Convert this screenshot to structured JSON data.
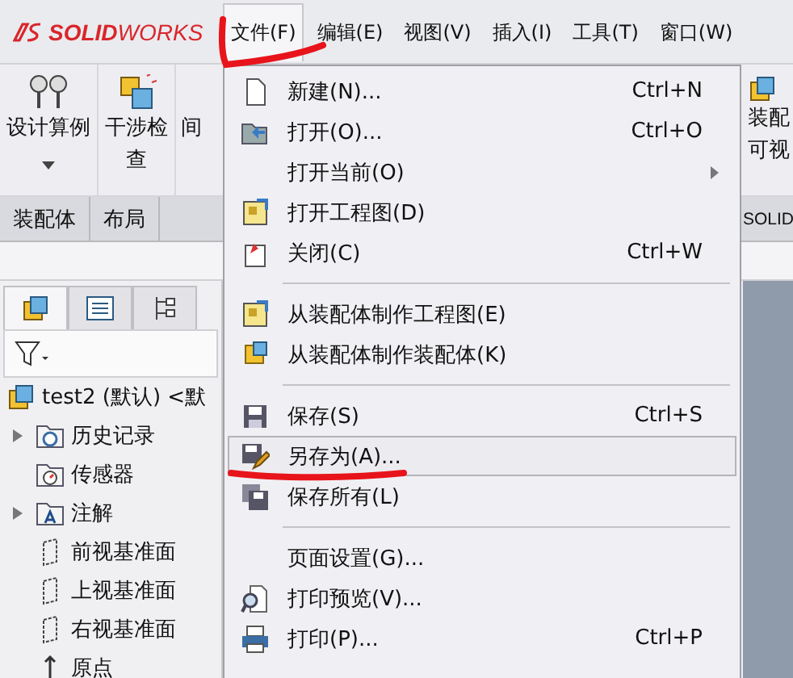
{
  "app_logo": {
    "text": "**SOLID**WORKS"
  },
  "menu_bar": [
    {
      "label": "文件(F)",
      "selected": true
    },
    {
      "label": "编辑(E)",
      "selected": false
    },
    {
      "label": "视图(V)",
      "selected": false
    },
    {
      "label": "插入(I)",
      "selected": false
    },
    {
      "label": "工具(T)",
      "selected": false
    },
    {
      "label": "窗口(W)",
      "selected": false
    }
  ],
  "toolbar": [
    "设计算例",
    "干涉检查",
    "间"
  ],
  "toolbar_right": {
    "label_lines": [
      "装配",
      "可视"
    ]
  },
  "command_tabs": [
    "装配体",
    "布局"
  ],
  "command_tabs_right": "SOLID",
  "panel_tabs": [
    {
      "selected": true
    },
    {
      "selected": false
    },
    {
      "selected": false
    }
  ],
  "tree": {
    "label": "test2 (默认) <默",
    "children": [
      {
        "label": "历史记录",
        "expandable": true
      },
      {
        "label": "传感器",
        "expandable": false
      },
      {
        "label": "注解",
        "expandable": true
      },
      {
        "label": "前视基准面",
        "expandable": false
      },
      {
        "label": "上视基准面",
        "expandable": false
      },
      {
        "label": "右视基准面",
        "expandable": false
      },
      {
        "label": "原点",
        "expandable": false
      }
    ]
  },
  "file_menu": [
    {
      "kind": "item",
      "label": "新建(N)...",
      "shortcut": "Ctrl+N",
      "submenu": false,
      "selected": false
    },
    {
      "kind": "item",
      "label": "打开(O)...",
      "shortcut": "Ctrl+O",
      "submenu": false,
      "selected": false
    },
    {
      "kind": "item",
      "label": "打开当前(O)",
      "submenu": true,
      "selected": false
    },
    {
      "kind": "item",
      "label": "打开工程图(D)",
      "submenu": false,
      "selected": false
    },
    {
      "kind": "item",
      "label": "关闭(C)",
      "shortcut": "Ctrl+W",
      "submenu": false,
      "selected": false
    },
    {
      "kind": "separator"
    },
    {
      "kind": "item",
      "label": "从装配体制作工程图(E)",
      "submenu": false,
      "selected": false
    },
    {
      "kind": "item",
      "label": "从装配体制作装配体(K)",
      "submenu": false,
      "selected": false
    },
    {
      "kind": "separator"
    },
    {
      "kind": "item",
      "label": "保存(S)",
      "shortcut": "Ctrl+S",
      "submenu": false,
      "selected": false
    },
    {
      "kind": "item",
      "label": "另存为(A)...",
      "submenu": false,
      "selected": true
    },
    {
      "kind": "item",
      "label": "保存所有(L)",
      "submenu": false,
      "selected": false
    },
    {
      "kind": "separator"
    },
    {
      "kind": "item",
      "label": "页面设置(G)...",
      "submenu": false,
      "selected": false
    },
    {
      "kind": "item",
      "label": "打印预览(V)...",
      "submenu": false,
      "selected": false
    },
    {
      "kind": "item",
      "label": "打印(P)...",
      "shortcut": "Ctrl+P",
      "submenu": false,
      "selected": false
    }
  ]
}
